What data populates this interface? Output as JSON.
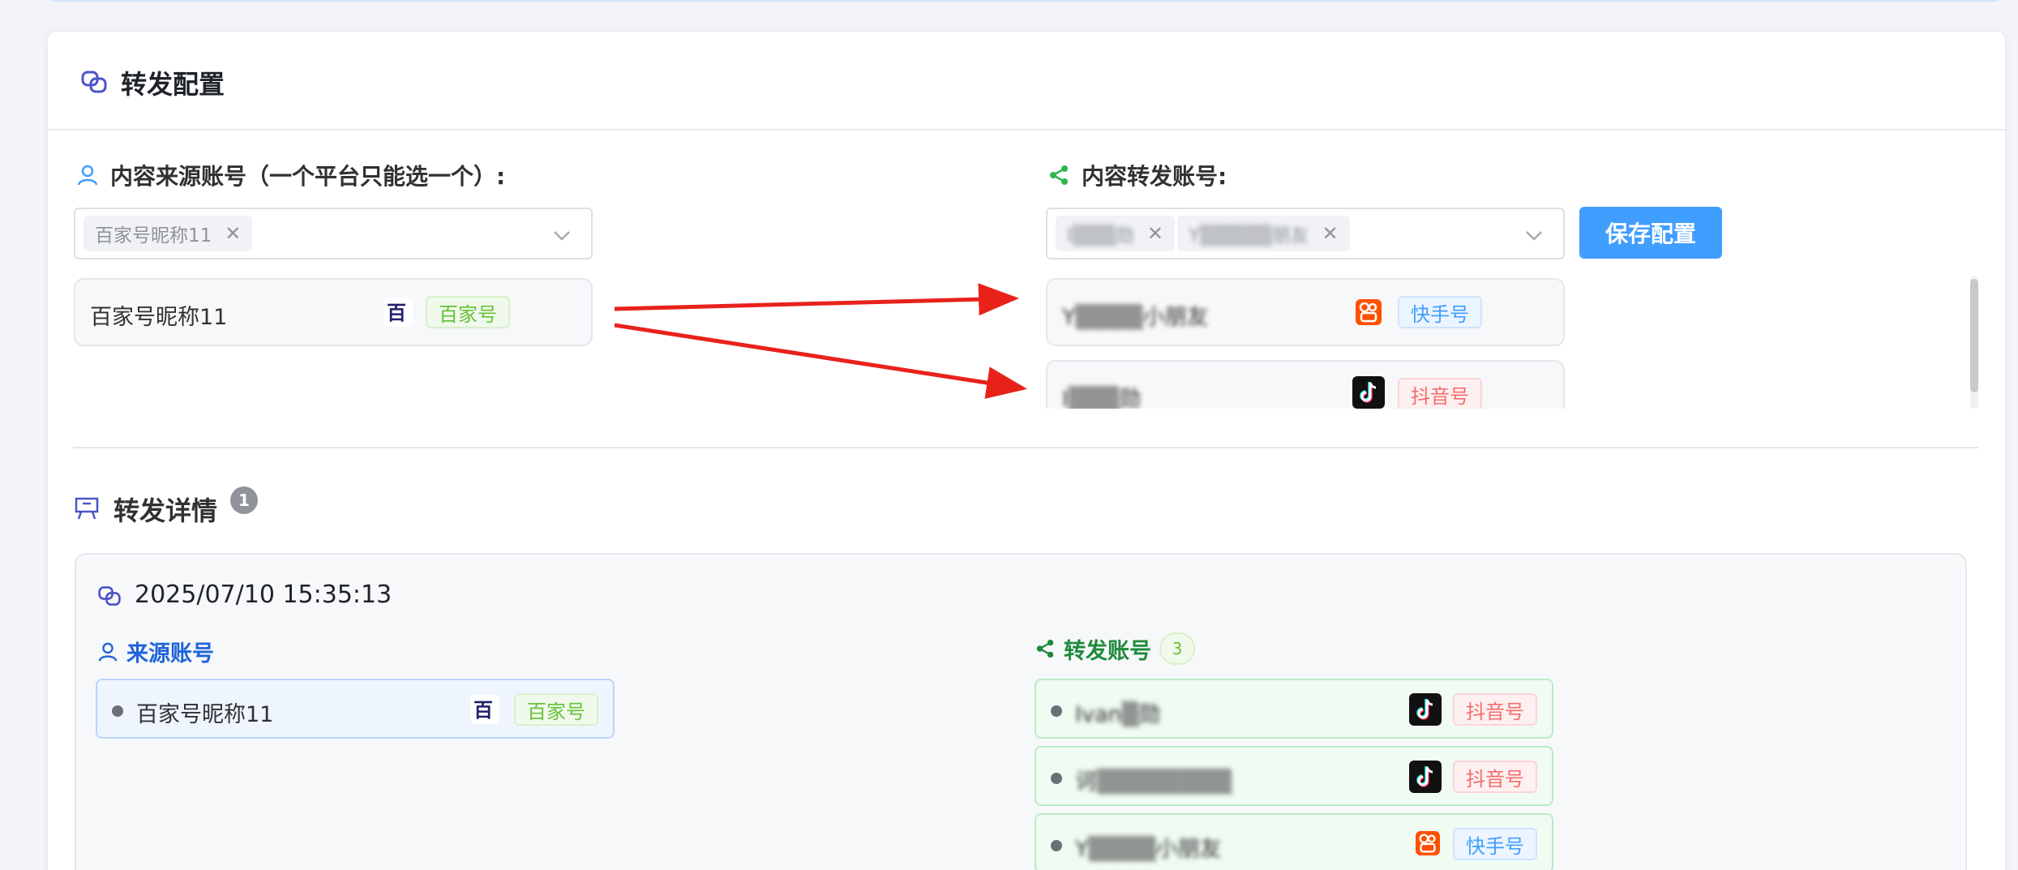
{
  "config": {
    "title": "转发配置",
    "source_label": "内容来源账号（一个平台只能选一个）:",
    "target_label": "内容转发账号:",
    "save_label": "保存配置",
    "source_select": {
      "tags": [
        "百家号昵称11"
      ]
    },
    "target_select": {
      "tags": [
        "I▒▒▒勋",
        "Y▒▒▒▒▒朋友"
      ]
    },
    "source_accounts": [
      {
        "name": "百家号昵称11",
        "platform": "百家号",
        "icon": "baijiahao-icon"
      }
    ],
    "target_accounts": [
      {
        "name": "Y▒▒▒▒小朋友",
        "platform": "快手号",
        "icon": "kuaishou-icon"
      },
      {
        "name": "I▒▒▒勋",
        "platform": "抖音号",
        "icon": "douyin-icon"
      }
    ],
    "arrow_color": "#e8221b"
  },
  "details": {
    "title": "转发详情",
    "count": "1",
    "records": [
      {
        "time": "2025/07/10 15:35:13",
        "source_label": "来源账号",
        "target_label": "转发账号",
        "target_count": "3",
        "source": {
          "name": "百家号昵称11",
          "platform": "百家号",
          "icon": "baijiahao-icon"
        },
        "targets": [
          {
            "name": "Ivan▒勋",
            "platform": "抖音号",
            "icon": "douyin-icon"
          },
          {
            "name": "诃▒▒▒▒▒▒▒▒",
            "platform": "抖音号",
            "icon": "douyin-icon"
          },
          {
            "name": "Y▒▒▒▒小朋友",
            "platform": "快手号",
            "icon": "kuaishou-icon"
          }
        ]
      }
    ]
  },
  "colors": {
    "primary": "#409eff",
    "success": "#67c23a",
    "danger": "#f56c6c",
    "kuaishou": "#ff5000",
    "douyin": "#111111"
  }
}
